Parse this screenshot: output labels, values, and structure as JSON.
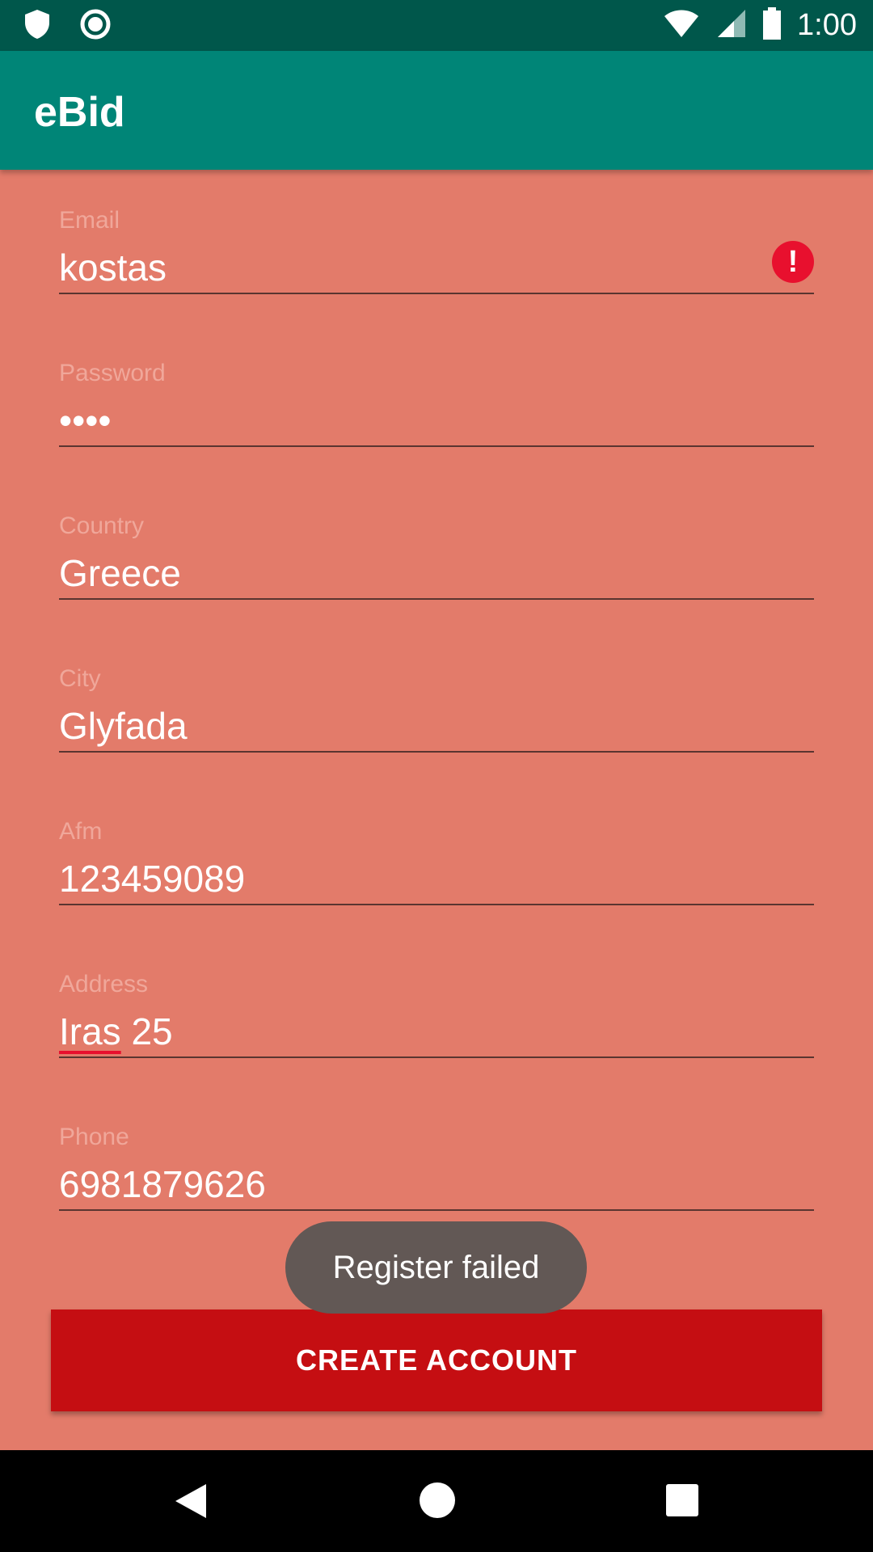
{
  "status_bar": {
    "time": "1:00",
    "icons": [
      "shield-icon",
      "circle-notification-icon",
      "wifi-icon",
      "signal-icon",
      "battery-icon"
    ]
  },
  "app_bar": {
    "title": "eBid"
  },
  "form": {
    "fields": [
      {
        "label": "Email",
        "value": "kostas",
        "error": true
      },
      {
        "label": "Password",
        "value": "••••"
      },
      {
        "label": "Country",
        "value": "Greece"
      },
      {
        "label": "City",
        "value": "Glyfada"
      },
      {
        "label": "Afm",
        "value": "123459089"
      },
      {
        "label": "Address",
        "value_misspelled": "Iras",
        "value_rest": " 25"
      },
      {
        "label": "Phone",
        "value": "6981879626"
      }
    ],
    "error_icon_glyph": "!",
    "submit_label": "CREATE ACCOUNT"
  },
  "toast": {
    "message": "Register failed"
  },
  "colors": {
    "status_bar": "#00574B",
    "app_bar": "#008577",
    "background": "#E37B6A",
    "button": "#C50E12",
    "error": "#E8102E"
  }
}
